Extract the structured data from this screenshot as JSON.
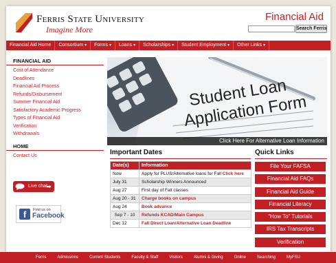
{
  "header": {
    "university_name": "Ferris State University",
    "tagline": "Imagine More",
    "site_title": "Financial Aid",
    "search_placeholder": "",
    "search_button": "Search Ferris"
  },
  "nav": [
    {
      "label": "Financial Aid Home",
      "has_menu": false
    },
    {
      "label": "Consortium",
      "has_menu": true
    },
    {
      "label": "Forms",
      "has_menu": true
    },
    {
      "label": "Loans",
      "has_menu": true
    },
    {
      "label": "Scholarships",
      "has_menu": true
    },
    {
      "label": "Student Employment",
      "has_menu": true
    },
    {
      "label": "Other Links",
      "has_menu": true
    }
  ],
  "sidebar": {
    "section1_title": "FINANCIAL AID",
    "section1_items": [
      "Cost of Attendance",
      "Deadlines",
      "Financial Aid Process",
      "Refunds/Disbursement",
      "Summer Financial Aid",
      "Satisfactory Academic Progress",
      "Types of Financial Aid",
      "Verification",
      "Withdrawals"
    ],
    "section2_title": "HOME",
    "section2_items": [
      "Contact Us"
    ],
    "livechat_label": "Live chat",
    "facebook_findus": "Find us on",
    "facebook_name": "Facebook"
  },
  "hero": {
    "form_title_line1": "Student Loan",
    "form_title_line2": "Application Form",
    "caption": "Click Here For Alternative Loan Information"
  },
  "important_dates": {
    "title": "Important Dates",
    "headers": [
      "Date(s)",
      "Information"
    ],
    "rows": [
      {
        "date": "Now",
        "info": "Apply for PLUS/Alternative loans for Fall",
        "link": "Click here",
        "red": false
      },
      {
        "date": "July 31",
        "info": "Scholarship Winners Announced",
        "link": "",
        "red": false
      },
      {
        "date": "Aug 27",
        "info": "First day of Fall classes",
        "link": "",
        "red": false
      },
      {
        "date": "Aug 20 - 31",
        "info": "Charge books on campus",
        "link": "",
        "red": true
      },
      {
        "date": "Aug 24",
        "info": "Book advance",
        "link": "",
        "red": true
      },
      {
        "date": "Sep 7 - 10",
        "info": "Refunds KCAD/Main Campus",
        "link": "",
        "red": true
      },
      {
        "date": "Dec 12",
        "info": "Fall Direct Loan/Alternative Loan Deadline",
        "link": "",
        "red": true
      }
    ]
  },
  "quick_links": {
    "title": "Quick Links",
    "items": [
      "File Your FAFSA",
      "Financial Aid FAQs",
      "Financial Aid Guide",
      "Financial Literacy",
      "“How To” Tutorials",
      "IRS Tax Transcripts",
      "Verification"
    ]
  },
  "footer": [
    "Ferris",
    "Admissions",
    "Current Students",
    "Faculty & Staff",
    "Visitors",
    "Alumni & Giving",
    "Online",
    "Searching",
    "MyFSU"
  ],
  "colors": {
    "accent": "#c21f25",
    "background": "#ece7dc",
    "facebook": "#3b5998"
  }
}
